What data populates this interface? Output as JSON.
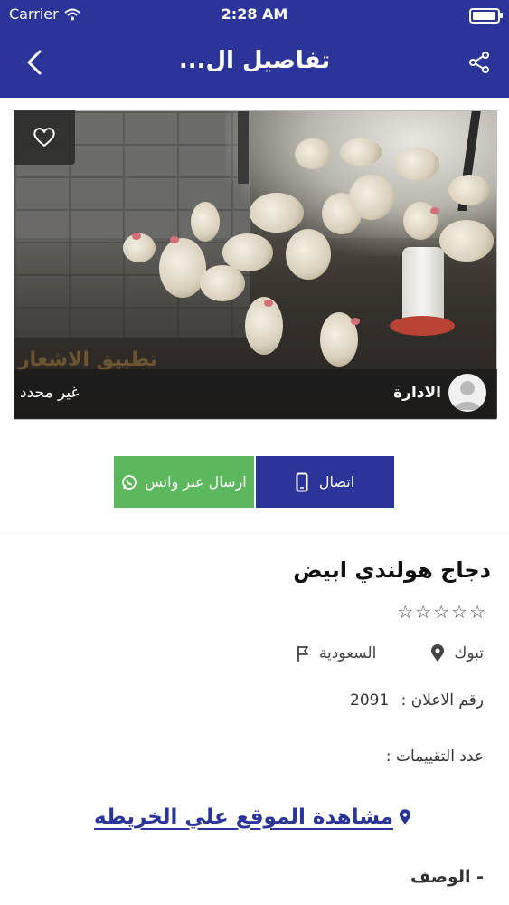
{
  "status_bar": {
    "carrier": "Carrier",
    "time": "2:28 AM",
    "battery_level": 0.9
  },
  "nav": {
    "title": "تفاصيل ال..."
  },
  "ad": {
    "price": "غير محدد",
    "owner": "الادارة",
    "watermark": "تطبيق الاشعار",
    "title": "دجاج هولندي ابيض",
    "rating": {
      "value": 0,
      "max": 5
    },
    "country": "السعودية",
    "city": "تبوك",
    "ad_number_label": "رقم الاعلان :",
    "ad_number": "2091",
    "ratings_count_label": "عدد التقييمات :",
    "map_link": "مشاهدة  الموقع علي الخريطه",
    "description_label": "- الوصف"
  },
  "actions": {
    "call_label": "اتصال",
    "whatsapp_label": "ارسال عبر واتس"
  },
  "colors": {
    "primary": "#2b3499",
    "whatsapp": "#5cb85c"
  },
  "icons": [
    "back-icon",
    "share-icon",
    "heart-icon",
    "avatar-icon",
    "phone-icon",
    "whatsapp-icon",
    "star-icon",
    "flag-icon",
    "location-pin-icon"
  ]
}
